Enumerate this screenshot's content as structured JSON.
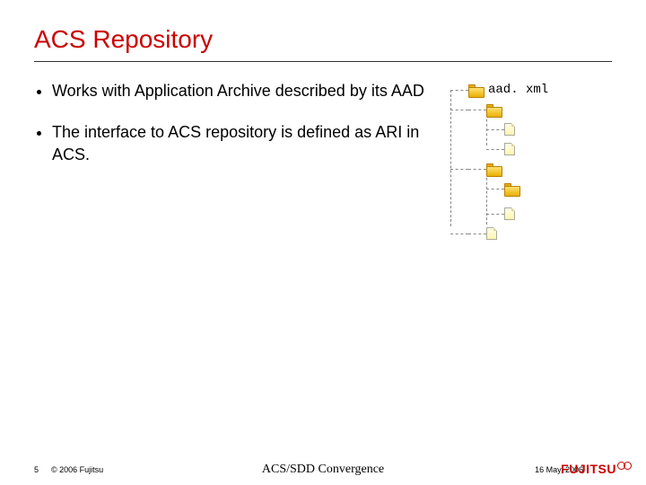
{
  "title": "ACS Repository",
  "bullets": [
    "Works with Application Archive described by its AAD",
    "The interface to ACS repository is defined as ARI in ACS."
  ],
  "tree": {
    "root_label": "aad. xml"
  },
  "footer": {
    "page": "5",
    "copyright": "© 2006 Fujitsu",
    "center": "ACS/SDD Convergence",
    "date": "16 May, 2006",
    "logo_text": "FUJITSU"
  }
}
